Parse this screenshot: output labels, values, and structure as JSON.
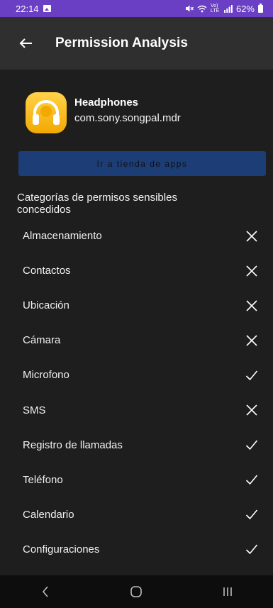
{
  "status_bar": {
    "time": "22:14",
    "network": "Vo) LTE",
    "battery": "62%"
  },
  "app_bar": {
    "title": "Permission Analysis"
  },
  "app": {
    "name": "Headphones",
    "package": "com.sony.songpal.mdr"
  },
  "store_button_label": "Ir a tienda de apps",
  "section_title": "Categorías de permisos sensibles concedidos",
  "permissions": [
    {
      "label": "Almacenamiento",
      "granted": false
    },
    {
      "label": "Contactos",
      "granted": false
    },
    {
      "label": "Ubicación",
      "granted": false
    },
    {
      "label": "Cámara",
      "granted": false
    },
    {
      "label": "Microfono",
      "granted": true
    },
    {
      "label": "SMS",
      "granted": false
    },
    {
      "label": "Registro de llamadas",
      "granted": true
    },
    {
      "label": "Teléfono",
      "granted": true
    },
    {
      "label": "Calendario",
      "granted": true
    },
    {
      "label": "Configuraciones",
      "granted": true
    }
  ],
  "colors": {
    "status_bar": "#6a3fc4",
    "app_bar": "#2f2f2f",
    "background": "#1e1e1e",
    "store_button": "#1c3d75",
    "app_icon": "#f5b400"
  }
}
